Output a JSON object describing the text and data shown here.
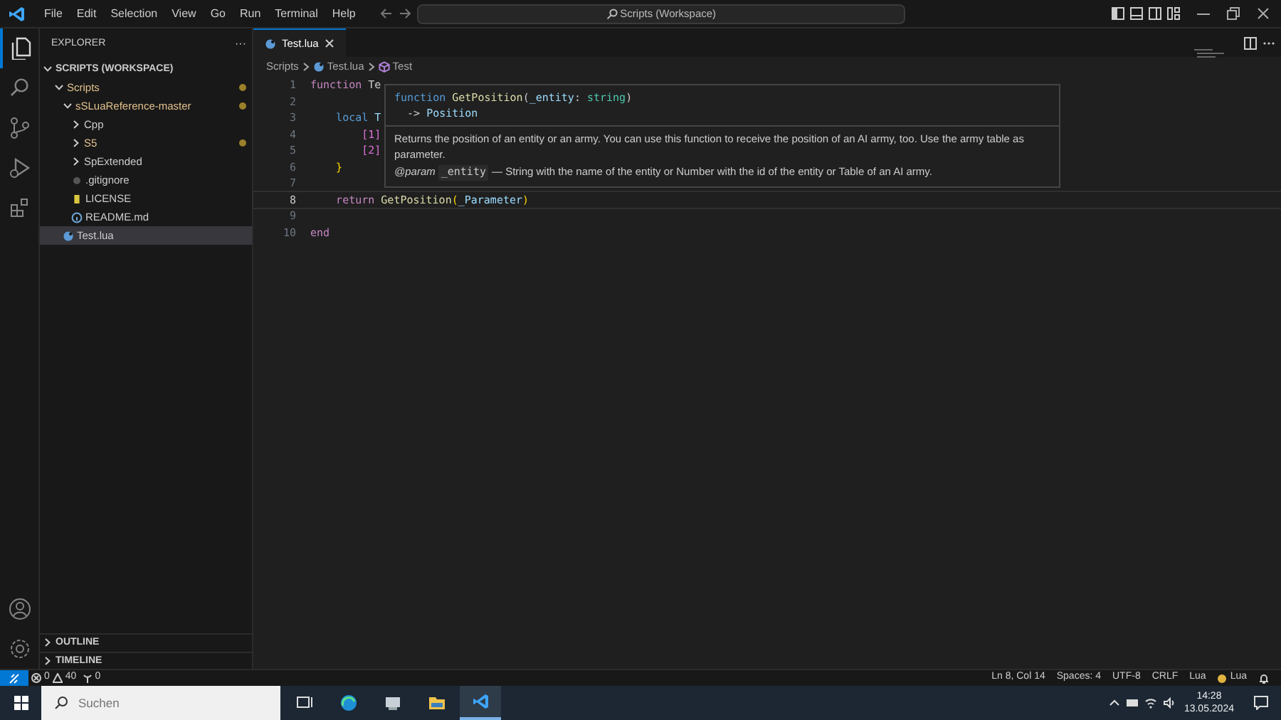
{
  "menu": [
    "File",
    "Edit",
    "Selection",
    "View",
    "Go",
    "Run",
    "Terminal",
    "Help"
  ],
  "command_center": "Scripts (Workspace)",
  "activity_bar": [
    {
      "kind": "files",
      "selected": true
    },
    {
      "kind": "search",
      "selected": false
    },
    {
      "kind": "source-control",
      "selected": false
    },
    {
      "kind": "run",
      "selected": false
    },
    {
      "kind": "extensions",
      "selected": false
    }
  ],
  "sidebar": {
    "title": "EXPLORER",
    "more": "···",
    "workspace": "SCRIPTS (WORKSPACE)",
    "tree": [
      {
        "label": "Scripts",
        "kind": "folder",
        "expanded": true,
        "modified": true,
        "selected": false,
        "children": [
          {
            "label": "sSLuaReference-master",
            "kind": "folder",
            "expanded": true,
            "modified": true,
            "selected": false,
            "children": [
              {
                "label": "Cpp",
                "kind": "folder",
                "expanded": false,
                "modified": false,
                "selected": false
              },
              {
                "label": "S5",
                "kind": "folder",
                "expanded": false,
                "modified": true,
                "selected": false
              },
              {
                "label": "SpExtended",
                "kind": "folder",
                "expanded": false,
                "modified": false,
                "selected": false
              },
              {
                "label": ".gitignore",
                "kind": "gitignore",
                "modified": false,
                "selected": false
              },
              {
                "label": "LICENSE",
                "kind": "license",
                "modified": false,
                "selected": false
              },
              {
                "label": "README.md",
                "kind": "info",
                "modified": false,
                "selected": false
              }
            ]
          },
          {
            "label": "Test.lua",
            "kind": "lua",
            "modified": false,
            "selected": true
          }
        ]
      }
    ],
    "sections": [
      {
        "label": "OUTLINE",
        "expanded": false
      },
      {
        "label": "TIMELINE",
        "expanded": false
      }
    ]
  },
  "tabs": [
    {
      "label": "Test.lua",
      "selected": true
    }
  ],
  "breadcrumbs": [
    {
      "label": "Scripts",
      "kind": "folder"
    },
    {
      "label": "Test.lua",
      "kind": "lua"
    },
    {
      "label": "Test",
      "kind": "symbol"
    }
  ],
  "code": [
    {
      "number": "1",
      "current": false,
      "tokens": [
        {
          "text": "function",
          "kind": "keyword"
        },
        {
          "text": " Te",
          "kind": "plain"
        }
      ]
    },
    {
      "number": "2",
      "current": false
    },
    {
      "number": "3",
      "current": false,
      "tokens": [
        {
          "text": "    local",
          "kind": "decl"
        },
        {
          "text": " T",
          "kind": "variable"
        }
      ]
    },
    {
      "number": "4",
      "current": false,
      "tokens": [
        {
          "text": "        [1]",
          "kind": "bracket"
        }
      ]
    },
    {
      "number": "5",
      "current": false,
      "tokens": [
        {
          "text": "        [2]",
          "kind": "bracket"
        }
      ]
    },
    {
      "number": "6",
      "current": false,
      "tokens": [
        {
          "text": "    }",
          "kind": "brace"
        }
      ]
    },
    {
      "number": "7",
      "current": false
    },
    {
      "number": "8",
      "current": true,
      "tokens": [
        {
          "text": "    return",
          "kind": "keyword"
        },
        {
          "text": " GetPosition",
          "kind": "function"
        },
        {
          "text": "(",
          "kind": "brace"
        },
        {
          "text": "_Parameter",
          "kind": "variable"
        },
        {
          "text": ")",
          "kind": "brace"
        }
      ]
    },
    {
      "number": "9",
      "current": false
    },
    {
      "number": "10",
      "current": false,
      "tokens": [
        {
          "text": "end",
          "kind": "keyword"
        }
      ]
    }
  ],
  "hover": {
    "signature": [
      [
        {
          "text": "function",
          "kind": "decl"
        },
        {
          "text": " GetPosition",
          "kind": "function"
        },
        {
          "text": "(",
          "kind": "plain"
        },
        {
          "text": "_entity",
          "kind": "variable"
        },
        {
          "text": ": ",
          "kind": "plain"
        },
        {
          "text": "string",
          "kind": "type"
        },
        {
          "text": ")",
          "kind": "plain"
        }
      ],
      [
        {
          "text": "  -> ",
          "kind": "plain"
        },
        {
          "text": "Position",
          "kind": "variable"
        }
      ]
    ],
    "description": "Returns the position of an entity or an army. You can use this function to receive the position of an AI army, too. Use the army table as parameter.",
    "param_tag": "@param",
    "param_name": "_entity",
    "param_text": "— String with the name of the entity or Number with the id of the entity or Table of an AI army."
  },
  "status_bar": {
    "errors": "0",
    "warnings": "40",
    "ports": "0",
    "right": [
      "Ln 8, Col 14",
      "Spaces: 4",
      "UTF-8",
      "CRLF",
      "Lua",
      "Lua"
    ]
  },
  "taskbar": {
    "search_placeholder": "Suchen",
    "apps": [
      {
        "kind": "task-view",
        "selected": false
      },
      {
        "kind": "browser",
        "selected": false
      },
      {
        "kind": "computer",
        "selected": false
      },
      {
        "kind": "folder",
        "selected": false
      },
      {
        "kind": "vscode",
        "selected": true
      }
    ],
    "time": "14:28",
    "date": "13.05.2024"
  }
}
